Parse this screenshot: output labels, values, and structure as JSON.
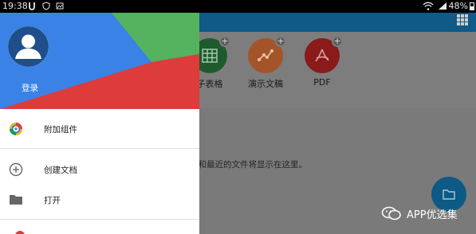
{
  "status_bar": {
    "time": "19:38",
    "battery": "48%",
    "icons": [
      "u-icon",
      "shield-icon",
      "image-icon",
      "wifi-icon",
      "signal-icon",
      "battery-icon"
    ]
  },
  "background_app": {
    "tiles": [
      {
        "label": "子表格",
        "icon": "spreadsheet-icon",
        "color": "#1f5a2e"
      },
      {
        "label": "演示文稿",
        "icon": "presentation-icon",
        "color": "#a5542a"
      },
      {
        "label": "PDF",
        "icon": "pdf-icon",
        "color": "#8b1a1a"
      }
    ],
    "empty_message": "夹和最近的文件将显示在这里。",
    "fab_icon": "folder-icon"
  },
  "drawer": {
    "login_label": "登录",
    "menu": [
      {
        "label": "附加组件",
        "icon": "addons-icon"
      },
      {
        "label": "创建文档",
        "icon": "add-circle-icon"
      },
      {
        "label": "打开",
        "icon": "folder-icon"
      }
    ]
  },
  "watermark": {
    "text": "APP优选集",
    "icon": "wechat-icon"
  },
  "colors": {
    "header_blue": "#3b82e6",
    "header_green": "#55b25e",
    "header_red": "#de3b3b",
    "app_bar": "#0f5a86"
  }
}
